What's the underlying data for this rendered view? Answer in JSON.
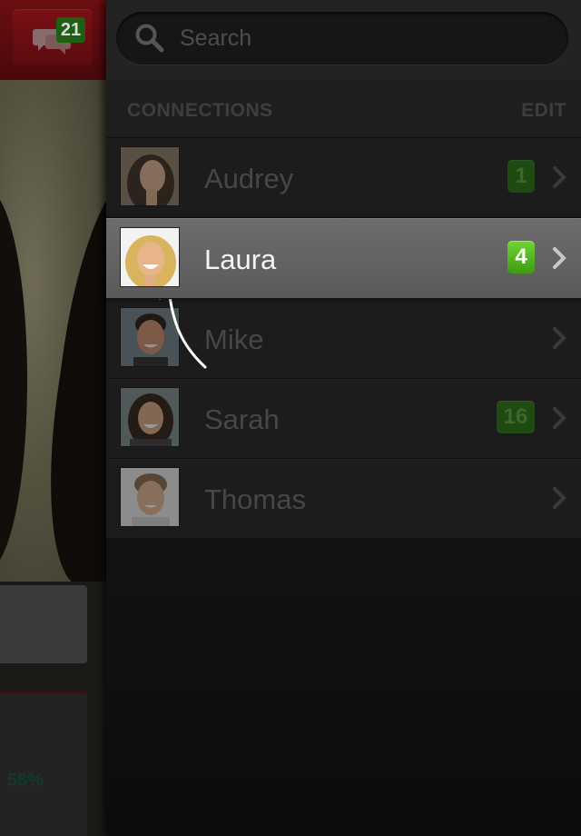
{
  "background_app": {
    "message_count": "21",
    "stat_percent": "58%"
  },
  "search": {
    "placeholder": "Search",
    "value": ""
  },
  "connections": {
    "title": "CONNECTIONS",
    "edit_label": "EDIT",
    "contacts": [
      {
        "name": "Audrey",
        "badge": "1"
      },
      {
        "name": "Laura",
        "badge": "4",
        "selected": true
      },
      {
        "name": "Mike",
        "badge": ""
      },
      {
        "name": "Sarah",
        "badge": "16"
      },
      {
        "name": "Thomas",
        "badge": ""
      }
    ]
  },
  "colors": {
    "badge_active": "#4fb81e",
    "badge_inactive": "#1f4a12",
    "header_red": "#6b0e12"
  }
}
